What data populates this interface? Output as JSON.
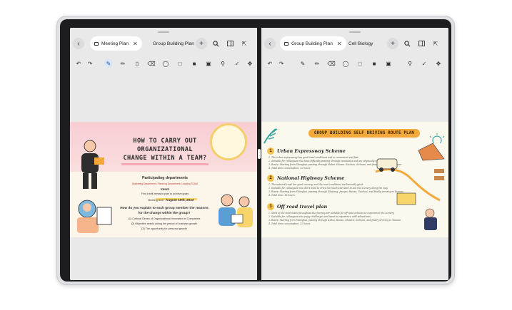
{
  "left_pane": {
    "tabs": [
      {
        "label": "Meeting Plan",
        "active": true
      },
      {
        "label": "Group Building Plan",
        "active": false
      }
    ],
    "slide": {
      "title_line1": "HOW TO CARRY OUT",
      "title_line2": "ORGANIZATIONAL",
      "title_line3": "CHANGE WITHIN A TEAM?",
      "participating_heading": "Participating departments",
      "departments": "Marketing Department, Planning Department, Leading TEAM",
      "intent_heading": "Intent",
      "intent_text": "Find a self-behavior plan to achieve goals",
      "meeting_time_label": "Meeting time:",
      "meeting_time_value": "August 10th, 2023",
      "question_line1": "How do you explain to each group member the reasons",
      "question_line2": "for the change within the group?",
      "point1": "(1) Cultural Genes of Organizational Innovation in Companies",
      "point2": "(2) Objective needs during the period of business growth",
      "point3": "(3) The opportunity for personal growth"
    }
  },
  "right_pane": {
    "tabs": [
      {
        "label": "Group Building Plan",
        "active": true
      },
      {
        "label": "Cell Biology",
        "active": false
      }
    ],
    "slide": {
      "banner": "GROUP BUILDING SELF DRIVING ROUTE PLAN",
      "sections": [
        {
          "number": "1",
          "heading": "Urban Expressway Scheme",
          "lines": [
            "1. The urban expressway has good road conditions and is convenient and fast.",
            "2. Suitable for colleagues who have difficulty passing through mountains and are physically challenged.",
            "3. Route: Starting from Shanghai, passing through Hubei, Hunan, Guizhou, Sichuan, and finally arriving in Yunnan.",
            "4. Total time consumption: 12 hours"
          ]
        },
        {
          "number": "2",
          "heading": "National Highway Scheme",
          "lines": [
            "1. The national road has good scenery, and the road conditions are basically good.",
            "2. Suitable for colleagues who don't want to drive too much and want to see the scenery along the way.",
            "3. Route: Starting from Shanghai, passing through Zhejiang, Jiangxi, Hunan, Guizhou, and finally arriving in Yunnan.",
            "4. Total time: 16 hours"
          ]
        },
        {
          "number": "3",
          "heading": "Off road travel plan",
          "lines": [
            "1. Most of the road roads throughout the journey are suitable for off-road vehicles to experience the scenery.",
            "2. Suitable for colleagues who enjoy challenges and want to experience wild adventures.",
            "3. Route: Starting from Shanghai, passing through Anhui, Henan, Shaanxi, Sichuan, and finally arriving in Yunnan.",
            "4. Total time consumption: 22 hours"
          ]
        }
      ]
    }
  }
}
